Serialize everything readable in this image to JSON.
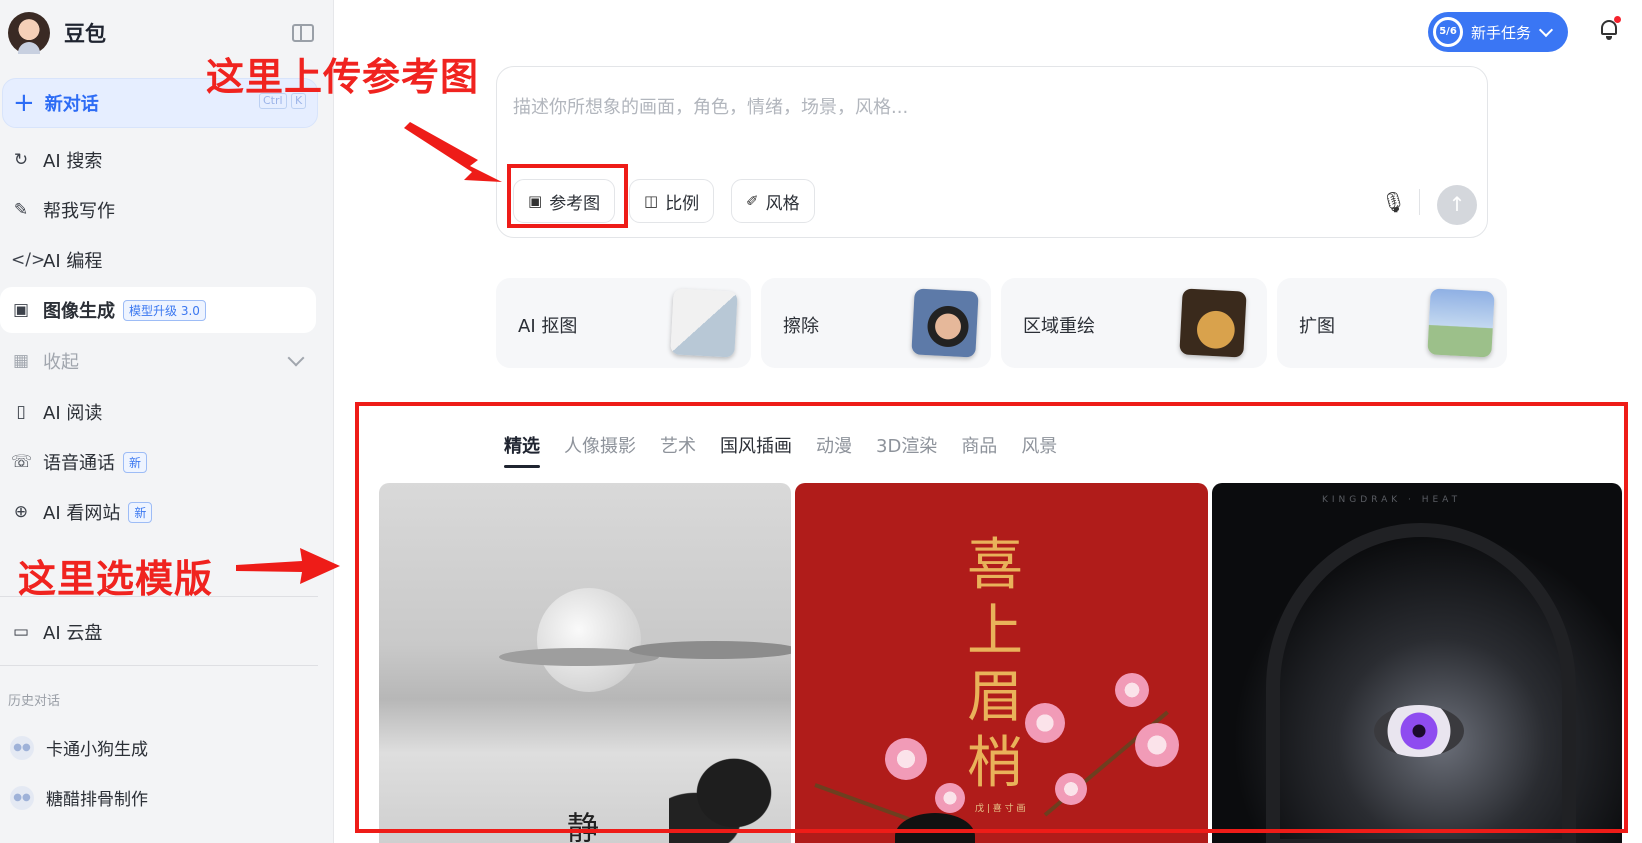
{
  "sidebar": {
    "brand": "豆包",
    "new_chat": {
      "label": "新对话",
      "kbd1": "Ctrl",
      "kbd2": "K"
    },
    "items": [
      {
        "label": "AI 搜索"
      },
      {
        "label": "帮我写作"
      },
      {
        "label": "AI 编程"
      },
      {
        "label": "图像生成",
        "badge": "模型升级 3.0"
      },
      {
        "label": "收起"
      },
      {
        "label": "AI 阅读"
      },
      {
        "label": "语音通话",
        "badge": "新"
      },
      {
        "label": "AI 看网站",
        "badge": "新"
      },
      {
        "label": "AI 云盘"
      }
    ],
    "history_title": "历史对话",
    "history": [
      {
        "label": "卡通小狗生成"
      },
      {
        "label": "糖醋排骨制作"
      }
    ]
  },
  "header": {
    "task_progress": "5/6",
    "task_label": "新手任务"
  },
  "prompt": {
    "placeholder": "描述你所想象的画面，角色，情绪，场景，风格...",
    "tools": [
      {
        "label": "参考图"
      },
      {
        "label": "比例"
      },
      {
        "label": "风格"
      }
    ]
  },
  "features": [
    {
      "label": "AI 抠图"
    },
    {
      "label": "擦除"
    },
    {
      "label": "区域重绘"
    },
    {
      "label": "扩图"
    }
  ],
  "tabs": [
    "精选",
    "人像摄影",
    "艺术",
    "国风插画",
    "动漫",
    "3D渲染",
    "商品",
    "风景"
  ],
  "gallery": {
    "card1_char": "静",
    "card2_title": "喜上眉梢",
    "card2_sub": "戊 | 喜 寸 画",
    "card3_top": "KINGDRAK · HEAT"
  },
  "annotations": {
    "upload": "这里上传参考图",
    "template": "这里选模版"
  },
  "colors": {
    "accent": "#2d6cf5",
    "annotation_red": "#ee1c18",
    "task_pill": "#3a76f4"
  }
}
